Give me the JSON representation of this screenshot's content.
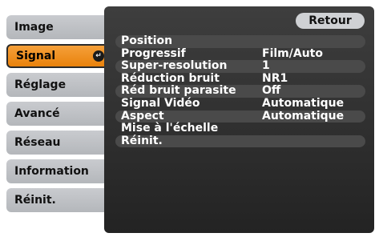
{
  "sidebar": {
    "tabs": [
      {
        "label": "Image"
      },
      {
        "label": "Signal",
        "active": true
      },
      {
        "label": "Réglage"
      },
      {
        "label": "Avancé"
      },
      {
        "label": "Réseau"
      },
      {
        "label": "Information"
      },
      {
        "label": "Réinit."
      }
    ],
    "enter_icon": "enter-icon"
  },
  "panel": {
    "back_label": "Retour",
    "rows": [
      {
        "label": "Position",
        "value": ""
      },
      {
        "label": "Progressif",
        "value": "Film/Auto"
      },
      {
        "label": "Super-resolution",
        "value": "1"
      },
      {
        "label": "Réduction bruit",
        "value": "NR1"
      },
      {
        "label": "Réd bruit parasite",
        "value": "Off"
      },
      {
        "label": "Signal Vidéo",
        "value": "Automatique"
      },
      {
        "label": "Aspect",
        "value": "Automatique"
      },
      {
        "label": "Mise à l'échelle",
        "value": ""
      },
      {
        "label": "Réinit.",
        "value": ""
      }
    ]
  },
  "colors": {
    "active_tab": "#e9820c",
    "tab": "#c0c2c6",
    "panel": "#2e2e2e",
    "row_highlight": "#4a4a4a"
  }
}
